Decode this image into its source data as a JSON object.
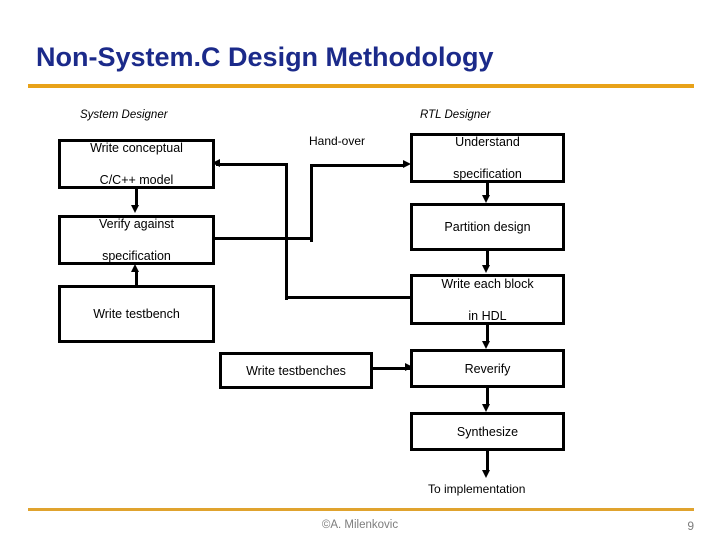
{
  "slide": {
    "title": "Non-System.C Design Methodology",
    "title_color": "#1b2a8a",
    "rule_color": "#e8a219",
    "page_number": "9",
    "credit": "©A. Milenkovic"
  },
  "columns": [
    {
      "label": "System Designer"
    },
    {
      "label": "RTL Designer"
    }
  ],
  "annotations": [
    {
      "label": "Hand-over"
    },
    {
      "label": "To implementation"
    }
  ],
  "boxes": {
    "left": [
      {
        "id": "write-conceptual-model",
        "line1": "Write conceptual",
        "line2": "C/C++ model"
      },
      {
        "id": "verify-against-specification",
        "line1": "Verify against",
        "line2": "specification"
      },
      {
        "id": "write-testbench",
        "line1": "Write testbench",
        "line2": ""
      },
      {
        "id": "write-testbenches",
        "line1": "Write testbenches",
        "line2": ""
      }
    ],
    "right": [
      {
        "id": "understand-specification",
        "line1": "Understand",
        "line2": "specification"
      },
      {
        "id": "partition-design",
        "line1": "Partition design",
        "line2": ""
      },
      {
        "id": "write-each-block-in-hdl",
        "line1": "Write each block",
        "line2": "in HDL"
      },
      {
        "id": "reverify",
        "line1": "Reverify",
        "line2": ""
      },
      {
        "id": "synthesize",
        "line1": "Synthesize",
        "line2": ""
      }
    ]
  }
}
